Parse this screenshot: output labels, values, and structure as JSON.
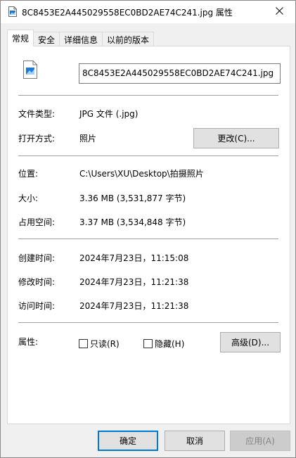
{
  "title": "8C8453E2A445029558EC0BD2AE74C241.jpg 属性",
  "tabs": [
    {
      "label": "常规",
      "active": true
    },
    {
      "label": "安全",
      "active": false
    },
    {
      "label": "详细信息",
      "active": false
    },
    {
      "label": "以前的版本",
      "active": false
    }
  ],
  "file_name": "8C8453E2A445029558EC0BD2AE74C241.jpg",
  "file_type": {
    "label": "文件类型:",
    "value": "JPG 文件 (.jpg)"
  },
  "open_with": {
    "label": "打开方式:",
    "value": "照片",
    "button": "更改(C)..."
  },
  "location": {
    "label": "位置:",
    "value": "C:\\Users\\XU\\Desktop\\拍摄照片"
  },
  "size": {
    "label": "大小:",
    "value": "3.36 MB (3,531,877 字节)"
  },
  "size_on_disk": {
    "label": "占用空间:",
    "value": "3.37 MB (3,534,848 字节)"
  },
  "created": {
    "label": "创建时间:",
    "value": "2024年7月23日，11:15:08"
  },
  "modified": {
    "label": "修改时间:",
    "value": "2024年7月23日，11:21:38"
  },
  "accessed": {
    "label": "访问时间:",
    "value": "2024年7月23日，11:21:38"
  },
  "attributes": {
    "label": "属性:",
    "readonly": "只读(R)",
    "hidden": "隐藏(H)",
    "advanced_button": "高级(D)..."
  },
  "footer": {
    "ok": "确定",
    "cancel": "取消",
    "apply": "应用(A)"
  },
  "icons": {
    "title": "image-file-icon",
    "close": "close-icon",
    "file": "image-file-icon"
  },
  "colors": {
    "accent": "#0078d7",
    "icon_blue": "#1e78d2"
  }
}
